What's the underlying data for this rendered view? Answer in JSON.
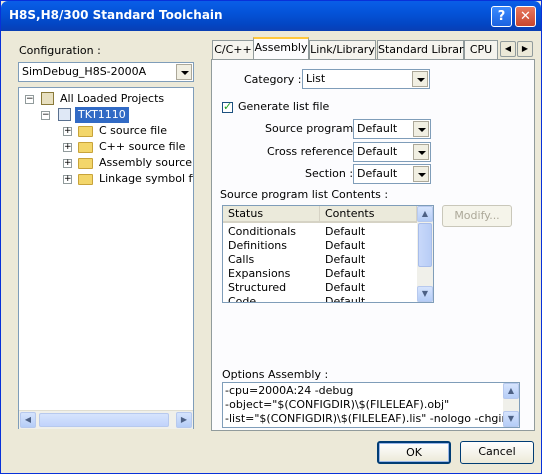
{
  "window": {
    "title": "H8S,H8/300 Standard Toolchain",
    "help_label": "?",
    "close_label": "✕"
  },
  "configuration": {
    "label": "Configuration :",
    "value": "SimDebug_H8S-2000A"
  },
  "tree": {
    "root": "All Loaded Projects",
    "project": "TKT1110",
    "folders": [
      "C source file",
      "C++ source file",
      "Assembly source file",
      "Linkage symbol file"
    ]
  },
  "tabs": [
    {
      "label": "C/C++"
    },
    {
      "label": "Assembly"
    },
    {
      "label": "Link/Library"
    },
    {
      "label": "Standard Library"
    },
    {
      "label": "CPU"
    }
  ],
  "category": {
    "label": "Category :",
    "value": "List"
  },
  "generate_list": {
    "label": "Generate list file",
    "checked": true
  },
  "source_program": {
    "label": "Source program :",
    "value": "Default"
  },
  "cross_reference": {
    "label": "Cross reference :",
    "value": "Default"
  },
  "section": {
    "label": "Section :",
    "value": "Default"
  },
  "contents_list": {
    "label": "Source program list Contents :",
    "headers": {
      "status": "Status",
      "contents": "Contents"
    },
    "rows": [
      {
        "status": "Conditionals",
        "contents": "Default"
      },
      {
        "status": "Definitions",
        "contents": "Default"
      },
      {
        "status": "Calls",
        "contents": "Default"
      },
      {
        "status": "Expansions",
        "contents": "Default"
      },
      {
        "status": "Structured",
        "contents": "Default"
      },
      {
        "status": "Code",
        "contents": "Default"
      }
    ]
  },
  "modify_button": "Modify...",
  "options": {
    "label": "Options Assembly :",
    "lines": [
      "-cpu=2000A:24 -debug",
      "-object=\"$(CONFIGDIR)\\$(FILELEAF).obj\"",
      "-list=\"$(CONFIGDIR)\\$(FILELEAF).lis\" -nologo -chgincpath"
    ]
  },
  "buttons": {
    "ok": "OK",
    "cancel": "Cancel"
  }
}
